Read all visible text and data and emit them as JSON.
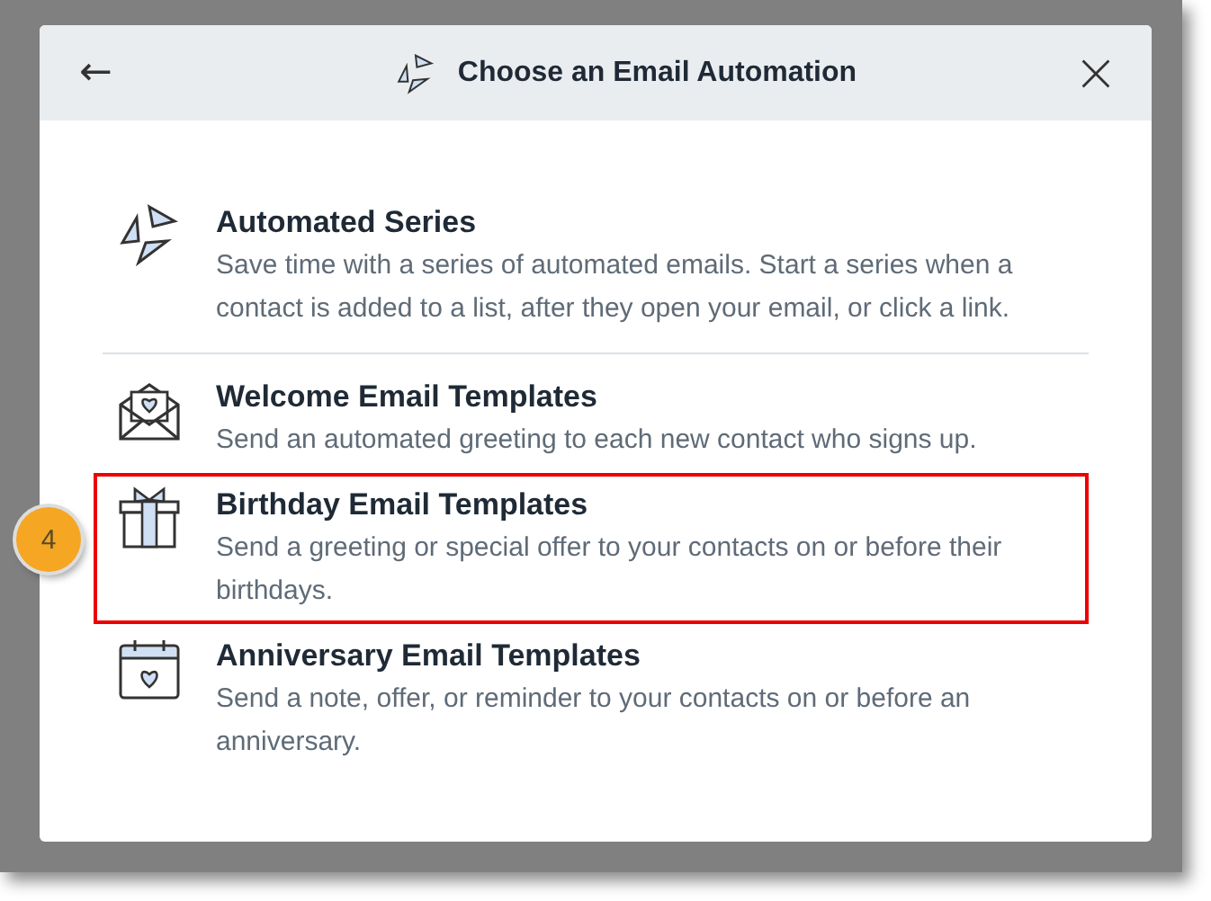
{
  "dialog": {
    "title": "Choose an Email Automation",
    "back_icon": "←"
  },
  "options": [
    {
      "kind": "series",
      "title": "Automated Series",
      "description": "Save time with a series of automated emails. Start a series when a contact is added to a list, after they open your email, or click a link.",
      "highlighted": false,
      "divider_after": true
    },
    {
      "kind": "welcome",
      "title": "Welcome Email Templates",
      "description": "Send an automated greeting to each new contact who signs up.",
      "highlighted": false,
      "divider_after": false
    },
    {
      "kind": "birthday",
      "title": "Birthday Email Templates",
      "description": "Send a greeting or special offer to your contacts on or before their birthdays.",
      "highlighted": true,
      "divider_after": false
    },
    {
      "kind": "anniversary",
      "title": "Anniversary Email Templates",
      "description": "Send a note, offer, or reminder to your contacts on or before an anniversary.",
      "highlighted": false,
      "divider_after": false
    }
  ],
  "callout": {
    "label": "4"
  }
}
